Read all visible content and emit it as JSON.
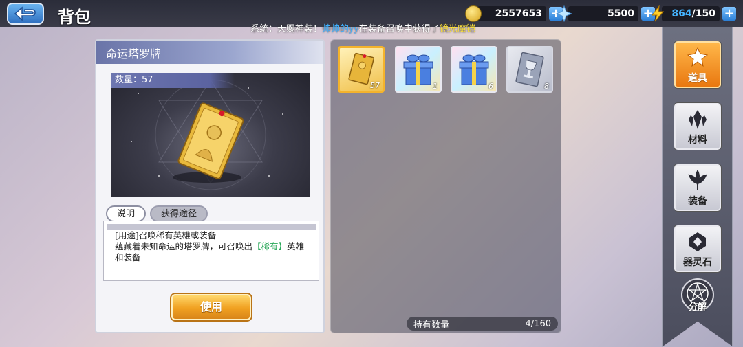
{
  "header": {
    "title": "背包",
    "resources": [
      {
        "icon": "gold-coin-icon",
        "value": "2557653"
      },
      {
        "icon": "diamond-star-icon",
        "value": "5500"
      },
      {
        "icon": "energy-bolt-icon",
        "value": "864",
        "max": "/150"
      }
    ]
  },
  "system_message": {
    "prefix": "系统：天赐神装！",
    "player": "帅帅的yy",
    "middle": "在装备召唤中获得了",
    "item": "镜光魔铠"
  },
  "detail": {
    "title": "命运塔罗牌",
    "quantity_label": "数量：57",
    "tabs": [
      {
        "label": "说明",
        "active": true
      },
      {
        "label": "获得途径",
        "active": false
      }
    ],
    "desc_line1": "[用途]召唤稀有英雄或装备",
    "desc_line2_a": "蕴藏着未知命运的塔罗牌，可召唤出",
    "desc_rare": "【稀有】",
    "desc_line2_b": "英雄",
    "desc_line3": "和装备",
    "use_button": "使用"
  },
  "inventory": {
    "items": [
      {
        "icon": "tarot-card-icon",
        "qty": "57",
        "selected": true
      },
      {
        "icon": "gift-box-icon",
        "qty": "1",
        "selected": false
      },
      {
        "icon": "gift-box-icon",
        "qty": "6",
        "selected": false
      },
      {
        "icon": "trophy-card-icon",
        "qty": "8",
        "selected": false
      }
    ],
    "held_label": "持有数量",
    "held_count": "4/160"
  },
  "nav": [
    {
      "label": "道具",
      "icon": "props-icon",
      "active": true
    },
    {
      "label": "材料",
      "icon": "crystal-icon",
      "active": false
    },
    {
      "label": "装备",
      "icon": "lily-icon",
      "active": false
    },
    {
      "label": "器灵石",
      "icon": "spirit-stone-icon",
      "active": false
    }
  ],
  "decompose_label": "分解",
  "colors": {
    "accent_orange": "#f0a020",
    "system_blue": "#3fb0ff",
    "system_yellow": "#ffe23a",
    "rare_green": "#2aa85a"
  }
}
